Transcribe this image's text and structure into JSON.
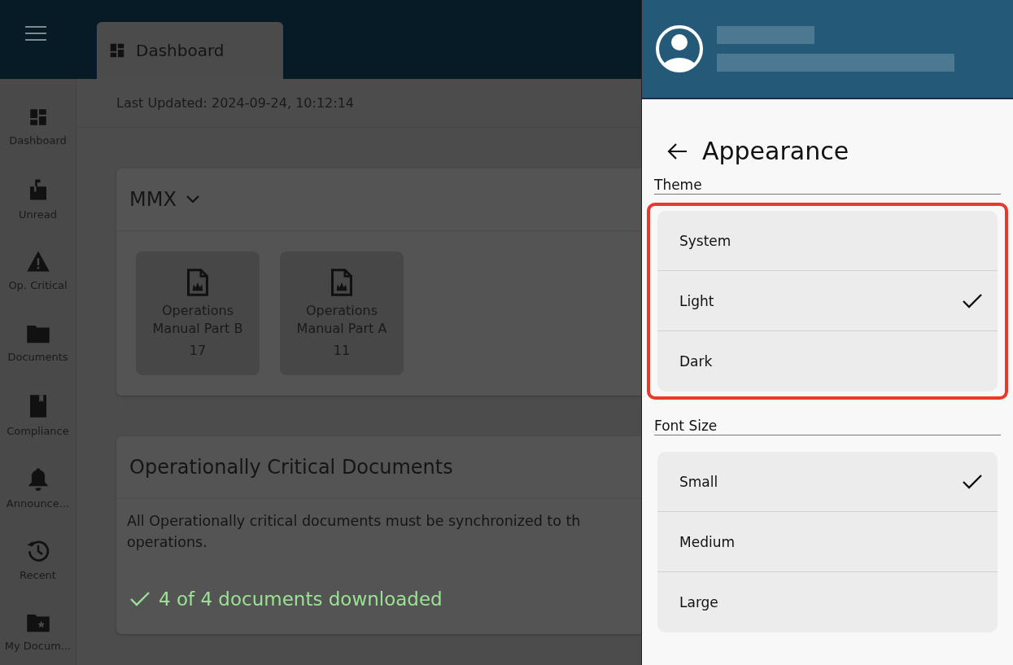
{
  "tab": {
    "label": "Dashboard",
    "selected": true
  },
  "sidebar": {
    "items": [
      {
        "label": "Dashboard"
      },
      {
        "label": "Unread"
      },
      {
        "label": "Op. Critical"
      },
      {
        "label": "Documents"
      },
      {
        "label": "Compliance"
      },
      {
        "label": "Announce..."
      },
      {
        "label": "Recent"
      },
      {
        "label": "My Docum..."
      }
    ]
  },
  "last_updated": "Last Updated: 2024-09-24, 10:12:14",
  "group_card": {
    "title": "MMX",
    "tiles": [
      {
        "title": "Operations Manual Part B",
        "count": "17"
      },
      {
        "title": "Operations Manual Part A",
        "count": "11"
      }
    ]
  },
  "critical_card": {
    "title": "Operationally Critical Documents",
    "lines": [
      "All Operationally critical documents must be synchronized to th",
      "operations."
    ],
    "status": "4 of 4 documents downloaded"
  },
  "panel": {
    "title": "Appearance",
    "sections": [
      {
        "label": "Theme",
        "highlighted": true,
        "options": [
          {
            "label": "System",
            "selected": false
          },
          {
            "label": "Light",
            "selected": true
          },
          {
            "label": "Dark",
            "selected": false
          }
        ]
      },
      {
        "label": "Font Size",
        "highlighted": false,
        "options": [
          {
            "label": "Small",
            "selected": true
          },
          {
            "label": "Medium",
            "selected": false
          },
          {
            "label": "Large",
            "selected": false
          }
        ]
      }
    ]
  }
}
